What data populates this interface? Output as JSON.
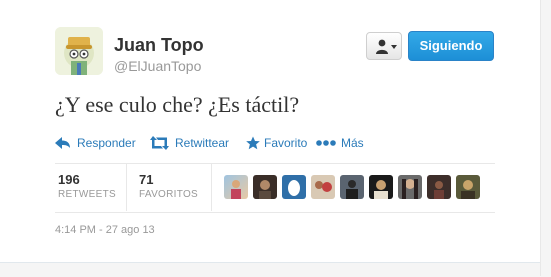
{
  "user": {
    "name": "Juan Topo",
    "handle": "@ElJuanTopo"
  },
  "follow_button_label": "Siguiendo",
  "tweet": {
    "text": "¿Y ese culo che? ¿Es táctil?"
  },
  "actions": {
    "reply": "Responder",
    "retweet": "Retwittear",
    "favorite": "Favorito",
    "more": "Más"
  },
  "stats": {
    "retweets_count": "196",
    "retweets_label": "RETWEETS",
    "favorites_count": "71",
    "favorites_label": "FAVORITOS"
  },
  "timestamp": "4:14 PM - 27 ago 13",
  "colors": {
    "link_blue": "#2b7bb9",
    "follow_blue": "#1d8fd6"
  },
  "icons": {
    "reply": "reply-arrow-icon",
    "retweet": "retweet-icon",
    "favorite": "star-icon",
    "more": "dots-icon",
    "user_menu": "person-icon"
  }
}
